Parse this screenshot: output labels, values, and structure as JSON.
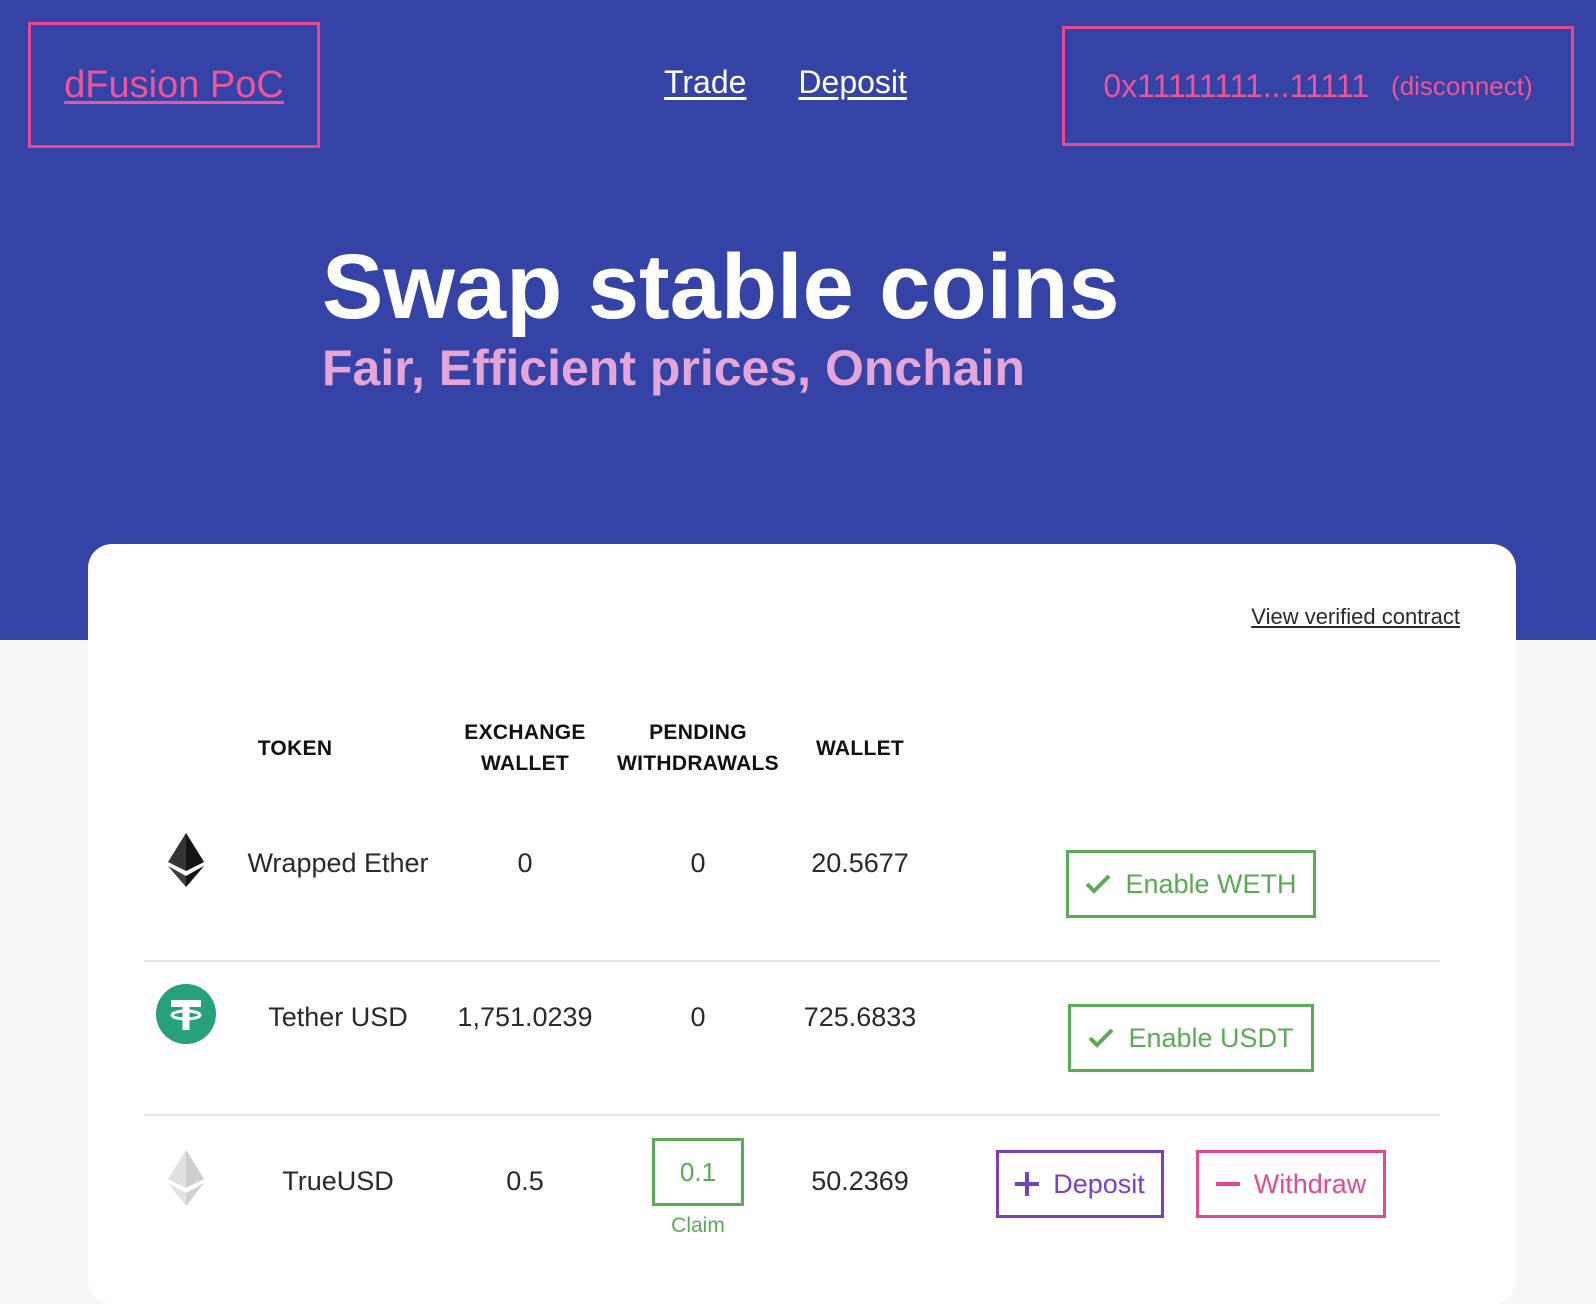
{
  "header": {
    "logo": "dFusion PoC",
    "nav": [
      {
        "label": "Trade"
      },
      {
        "label": "Deposit"
      }
    ],
    "account_address": "0x11111111...11111",
    "disconnect_label": "(disconnect)"
  },
  "hero": {
    "title": "Swap stable coins",
    "subtitle": "Fair, Efficient prices, Onchain"
  },
  "card": {
    "verified_link": "View verified contract",
    "columns": {
      "token": "TOKEN",
      "exchange_wallet_1": "EXCHANGE",
      "exchange_wallet_2": "WALLET",
      "pending_1": "PENDING",
      "pending_2": "WITHDRAWALS",
      "wallet": "WALLET"
    },
    "rows": [
      {
        "icon": "ethereum-dark-icon",
        "name": "Wrapped Ether",
        "exchange_wallet": "0",
        "pending_withdrawals": "0",
        "wallet": "20.5677",
        "action_label": "Enable WETH"
      },
      {
        "icon": "tether-icon",
        "name": "Tether USD",
        "exchange_wallet": "1,751.0239",
        "pending_withdrawals": "0",
        "wallet": "725.6833",
        "action_label": "Enable USDT"
      },
      {
        "icon": "ethereum-light-icon",
        "name": "TrueUSD",
        "exchange_wallet": "0.5",
        "pending_withdrawals": "0.1",
        "claim_label": "Claim",
        "wallet": "50.2369",
        "deposit_label": "Deposit",
        "withdraw_label": "Withdraw"
      }
    ]
  },
  "colors": {
    "hero_bg": "#3543a6",
    "accent_pink": "#e8488e",
    "subtitle_pink": "#e4a6d8",
    "success_green": "#5aab55",
    "deposit_purple": "#7b3fc7",
    "tether_green": "#26a17b"
  }
}
